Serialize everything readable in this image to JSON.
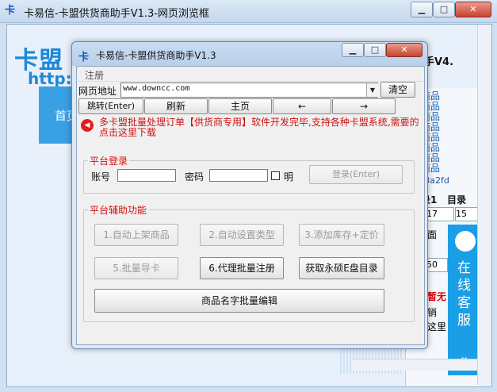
{
  "outer_window": {
    "title": "卡易信-卡盟供货商助手V1.3-网页浏览框",
    "icon": "卡"
  },
  "background_page": {
    "logo_text": "卡盟",
    "url_fragment": "http:",
    "nav_item": "首页",
    "right_title": "商助手V4.",
    "link_items": [
      "个商品",
      "个商品",
      "个商品",
      "个商品",
      "个商品",
      "个商品",
      "个商品",
      "个商品"
    ],
    "color_code": "#03a2fd",
    "mulu_1": "目录1",
    "mulu_2": "目录",
    "input_1": "17",
    "input_2": "15",
    "radio_label": "面",
    "input_3": "50",
    "red_text": "暂无",
    "radio_2": "销",
    "here_text": "这里",
    "online_service": "在线客服",
    "side_arrow": "«"
  },
  "dialog": {
    "icon": "卡",
    "title": "卡易信-卡盟供货商助手V1.3",
    "menu": {
      "register": "注册"
    },
    "address": {
      "label": "网页地址",
      "value": "www.downcc.com",
      "clear_button": "清空"
    },
    "nav_buttons": {
      "go": "跳转(Enter)",
      "refresh": "刷新",
      "home": "主页",
      "back": "←",
      "forward": "→"
    },
    "notice": "多卡盟批量处理订单【供货商专用】软件开发完毕,支持各种卡盟系统,需要的点击这里下载",
    "login_group": {
      "title": "平台登录",
      "account_label": "账号",
      "account_value": "",
      "password_label": "密码",
      "password_value": "",
      "show_label": "明",
      "login_button": "登录(Enter)"
    },
    "helper_group": {
      "title": "平台辅助功能",
      "buttons": [
        {
          "label": "1.自动上架商品",
          "enabled": false
        },
        {
          "label": "2.自动设置类型",
          "enabled": false
        },
        {
          "label": "3.添加库存+定价",
          "enabled": false
        },
        {
          "label": "5.批量导卡",
          "enabled": false
        },
        {
          "label": "6.代理批量注册",
          "enabled": true
        },
        {
          "label": "获取永硕E盘目录",
          "enabled": true
        }
      ],
      "batch_edit": "商品名字批量编辑"
    }
  },
  "colors": {
    "accent_blue": "#1e88d8",
    "notice_red": "#d01010",
    "service_blue": "#1a9ee6"
  }
}
